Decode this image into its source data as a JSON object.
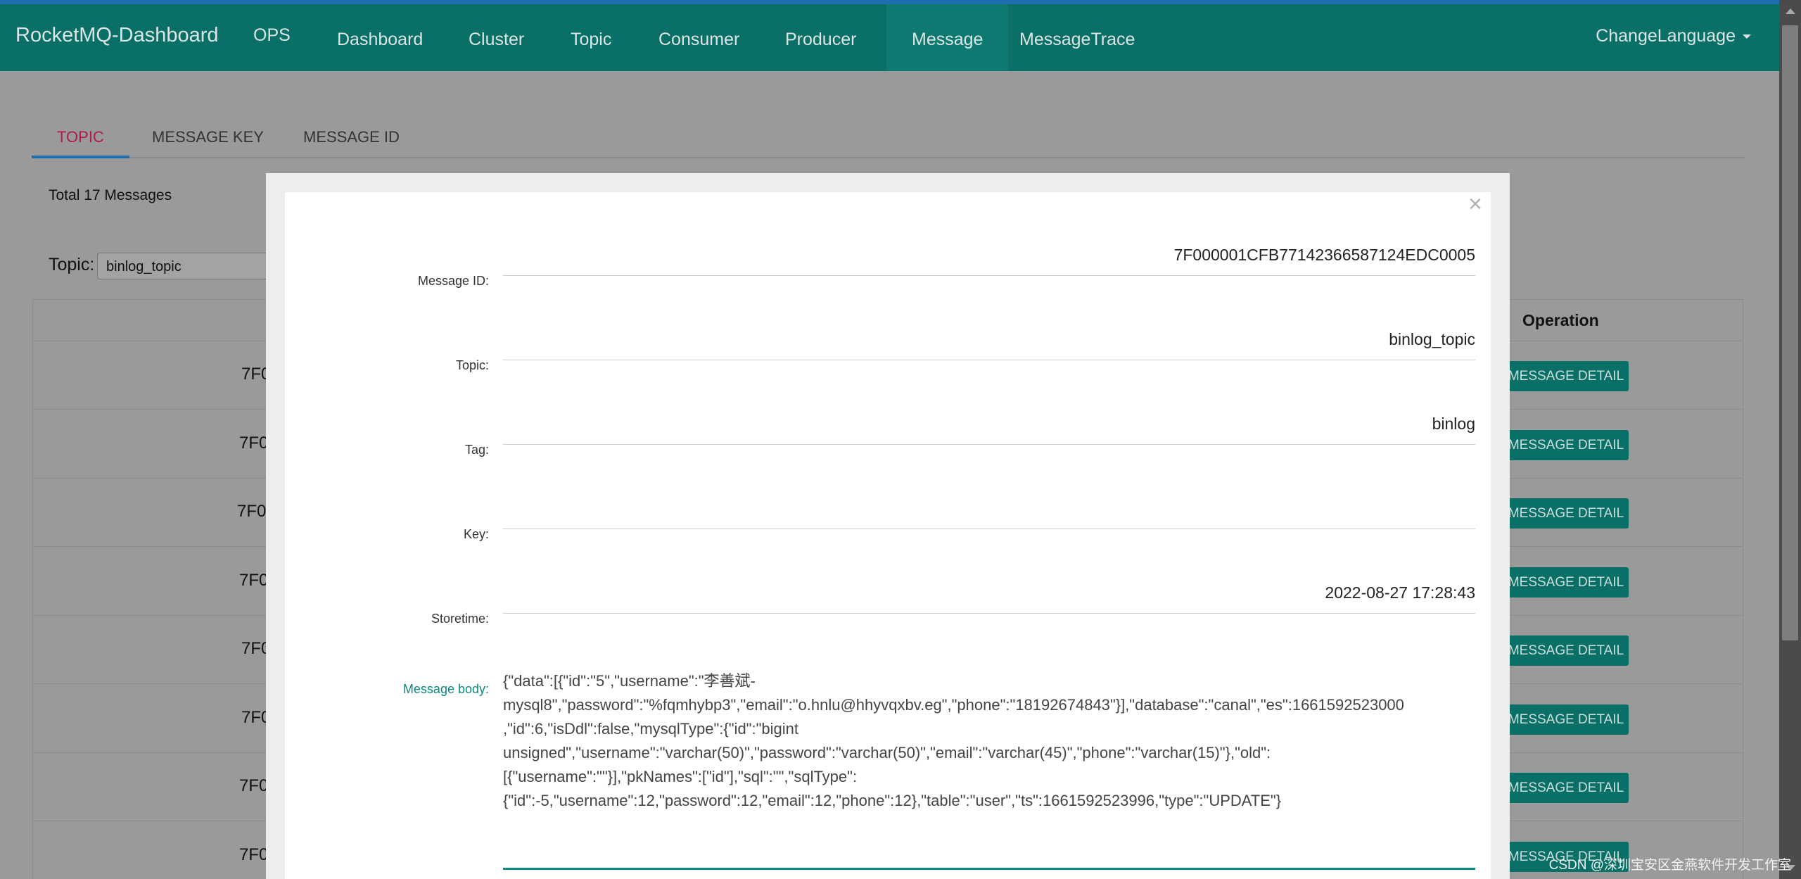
{
  "navbar": {
    "brand": "RocketMQ-Dashboard",
    "items": [
      "OPS",
      "Dashboard",
      "Cluster",
      "Topic",
      "Consumer",
      "Producer",
      "Message",
      "MessageTrace"
    ],
    "active": "Message",
    "language_label": "ChangeLanguage"
  },
  "page": {
    "tabs": [
      "TOPIC",
      "MESSAGE KEY",
      "MESSAGE ID"
    ],
    "active_tab": "TOPIC",
    "total_text": "Total 17 Messages",
    "topic_label": "Topic:",
    "topic_value": "binlog_topic",
    "table": {
      "operation_header": "Operation",
      "row_id_prefix": "7F0",
      "detail_button_label": "MESSAGE DETAIL",
      "visible_rows": 8
    }
  },
  "modal": {
    "close_label": "×",
    "message_id_label": "Message ID:",
    "message_id": "7F000001CFB77142366587124EDC0005",
    "topic_label": "Topic:",
    "topic": "binlog_topic",
    "tag_label": "Tag:",
    "tag": "binlog",
    "key_label": "Key:",
    "key": "",
    "storetime_label": "Storetime:",
    "storetime": "2022-08-27 17:28:43",
    "body_label": "Message body:",
    "body": "{\"data\":[{\"id\":\"5\",\"username\":\"李善斌-\nmysql8\",\"password\":\"%fqmhybp3\",\"email\":\"o.hnlu@hhyvqxbv.eg\",\"phone\":\"18192674843\"}],\"database\":\"canal\",\"es\":1661592523000\n,\"id\":6,\"isDdl\":false,\"mysqlType\":{\"id\":\"bigint\nunsigned\",\"username\":\"varchar(50)\",\"password\":\"varchar(50)\",\"email\":\"varchar(45)\",\"phone\":\"varchar(15)\"},\"old\":\n[{\"username\":\"\"}],\"pkNames\":[\"id\"],\"sql\":\"\",\"sqlType\":\n{\"id\":-5,\"username\":12,\"password\":12,\"email\":12,\"phone\":12},\"table\":\"user\",\"ts\":1661592523996,\"type\":\"UPDATE\"}"
  },
  "watermark": "CSDN @深圳宝安区金燕软件开发工作室",
  "colors": {
    "navbar": "#0a6f66",
    "accent": "#0a8a7e",
    "active_tab": "#b01b48"
  }
}
